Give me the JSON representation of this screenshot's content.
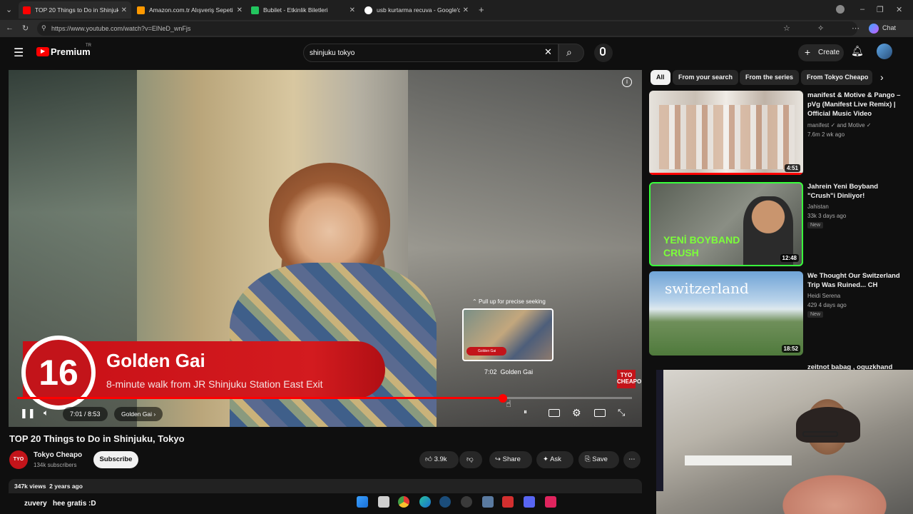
{
  "browser": {
    "tabs": [
      {
        "title": "TOP 20 Things to Do in Shinjuku",
        "active": true,
        "fav": "#ff0000"
      },
      {
        "title": "Amazon.com.tr Alışveriş Sepeti",
        "active": false,
        "fav": "#ff9900"
      },
      {
        "title": "Bubilet - Etkinlik Biletleri",
        "active": false,
        "fav": "#22c55e"
      },
      {
        "title": "usb kurtarma recuva - Google'da A",
        "active": false,
        "fav": "#ffffff"
      }
    ],
    "url": "https://www.youtube.com/watch?v=ElNeD_wnFjs",
    "chat_label": "Chat"
  },
  "yt": {
    "logo": "Premium",
    "logo_region": "TR",
    "search_value": "shinjuku tokyo",
    "create_label": "Create"
  },
  "video": {
    "chapter_number": "16",
    "chapter_title": "Golden Gai",
    "chapter_subtitle": "8-minute walk from JR Shinjuku Station East Exit",
    "brand_badge": "TYO CHEAPO",
    "preview_hint": "Pull up for precise seeking",
    "preview_time": "7:02",
    "preview_chapter": "Golden Gai",
    "preview_badge": "Golden Gai",
    "current_time": "7:01 / 8:53",
    "chapter_pill": "Golden Gai",
    "progress": 0.79
  },
  "meta": {
    "title": "TOP 20 Things to Do in Shinjuku, Tokyo",
    "channel": "Tokyo Cheapo",
    "channel_avatar": "TYO",
    "subscribers": "134k subscribers",
    "subscribe_label": "Subscribe",
    "likes": "3.9k",
    "share_label": "Share",
    "ask_label": "Ask",
    "save_label": "Save",
    "views_line": "347k views  2 years ago"
  },
  "sidebar": {
    "chips": [
      "All",
      "From your search",
      "From the series",
      "From Tokyo Cheapo"
    ],
    "recs": [
      {
        "title": "manifest & Motive & Pango – pVg (Manifest Live Remix) | Official Music Video",
        "channel": "manifest ✓ and Motive ✓",
        "stats": "7.6m  2 wk ago",
        "duration": "4:51",
        "new": ""
      },
      {
        "title": "Jahrein Yeni Boyband \"Crush\"i Dinliyor!",
        "channel": "Jahistan",
        "stats": "33k  3 days ago",
        "duration": "12:48",
        "new": "New"
      },
      {
        "title": "We Thought Our Switzerland Trip Was Ruined... CH",
        "channel": "Heidi Serena",
        "stats": "429  4 days ago",
        "duration": "18:52",
        "new": "New"
      },
      {
        "title": "zeitnot babag , oguzkhand",
        "channel": "",
        "stats": "",
        "duration": "",
        "new": ""
      }
    ],
    "thumb_text_2": "YENİ BOYBAND CRUSH",
    "thumb_text_3": "switzerland"
  },
  "chat": {
    "user": "zuvery",
    "message": "hee gratis :D"
  }
}
